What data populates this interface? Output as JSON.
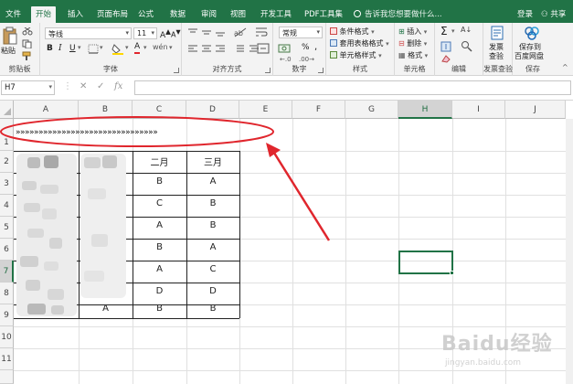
{
  "menu": {
    "tabs": [
      "文件",
      "开始",
      "插入",
      "页面布局",
      "公式",
      "数据",
      "审阅",
      "视图",
      "开发工具",
      "PDF工具集"
    ],
    "active_tab": "开始",
    "tell_me": "告诉我您想要做什么...",
    "login": "登录",
    "share": "共享"
  },
  "ribbon": {
    "paste_label": "粘贴",
    "groups": {
      "clipboard": "剪贴板",
      "font": "字体",
      "alignment": "对齐方式",
      "number": "数字",
      "styles": "样式",
      "cells": "单元格",
      "editing": "编辑",
      "invoice": "发票查验",
      "save": "保存"
    },
    "font_name": "等线",
    "font_size": "11",
    "bold": "B",
    "italic": "I",
    "underline": "U",
    "font_color_glyph": "A",
    "wen": "wén",
    "number_format": "常规",
    "percent": "%",
    "comma": ",",
    "styles_items": [
      "条件格式",
      "套用表格格式",
      "单元格样式"
    ],
    "cells_items": [
      "插入",
      "删除",
      "格式"
    ],
    "invoice_button": [
      "发票",
      "查验"
    ],
    "save_button": [
      "保存到",
      "百度网盘"
    ],
    "sigma": "Σ",
    "sort_glyph": "A↓"
  },
  "formula_bar": {
    "name_box": "H7",
    "cancel": "✕",
    "enter": "✓",
    "fx": "fx",
    "content": ""
  },
  "sheet": {
    "columns": [
      "A",
      "B",
      "C",
      "D",
      "E",
      "F",
      "G",
      "H",
      "I",
      "J"
    ],
    "selected_column": "H",
    "rows": [
      "1",
      "2",
      "3",
      "4",
      "5",
      "6",
      "7",
      "8",
      "9",
      "10",
      "11"
    ],
    "selected_row": "7",
    "row1_text": "»»»»»»»»»»»»»»»»»»»»»»»»»»»»»»»",
    "header_row": [
      "",
      "",
      "二月",
      "三月"
    ],
    "data": [
      [
        "",
        "",
        "B",
        "A"
      ],
      [
        "",
        "",
        "C",
        "B"
      ],
      [
        "",
        "",
        "A",
        "B"
      ],
      [
        "",
        "",
        "B",
        "A"
      ],
      [
        "",
        "",
        "A",
        "C"
      ],
      [
        "",
        "",
        "D",
        "D"
      ],
      [
        "",
        "A",
        "B",
        "B"
      ]
    ],
    "annotation_color": "#e0262d",
    "selection_color": "#217346"
  },
  "watermark": {
    "text": "Baidu经验",
    "sub": "jingyan.baidu.com"
  }
}
